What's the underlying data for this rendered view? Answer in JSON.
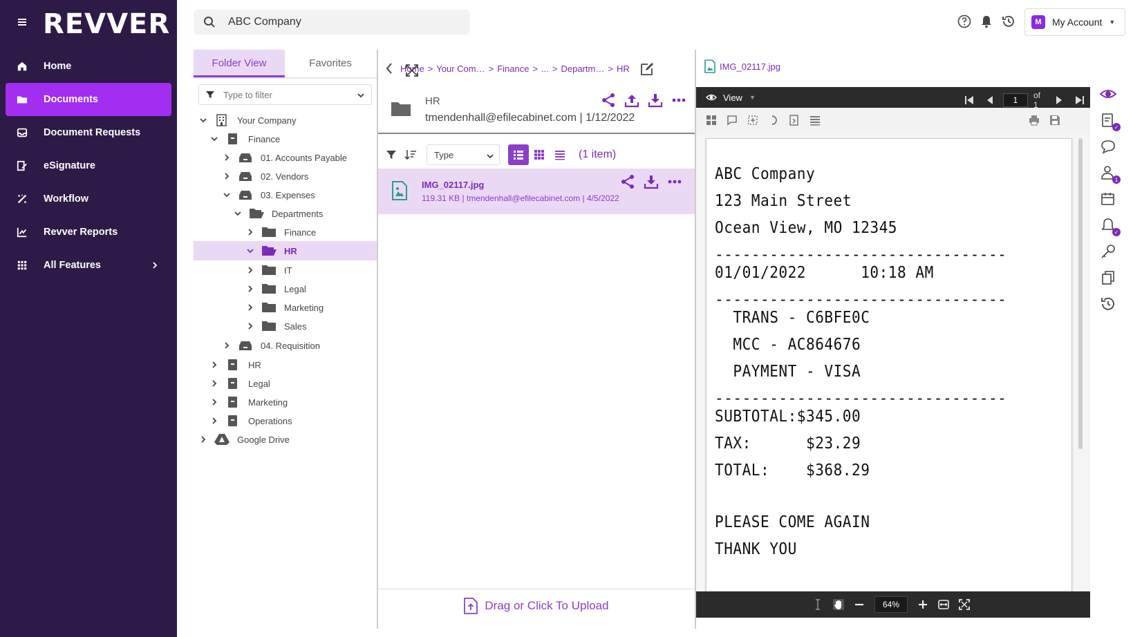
{
  "brand": {
    "logo": "REVVER"
  },
  "sidebar": {
    "items": [
      {
        "label": "Home",
        "icon": "home-icon",
        "active": false
      },
      {
        "label": "Documents",
        "icon": "documents-icon",
        "active": true
      },
      {
        "label": "Document Requests",
        "icon": "document-requests-icon",
        "active": false
      },
      {
        "label": "eSignature",
        "icon": "esignature-icon",
        "active": false
      },
      {
        "label": "Workflow",
        "icon": "workflow-icon",
        "active": false
      },
      {
        "label": "Revver Reports",
        "icon": "reports-icon",
        "active": false
      },
      {
        "label": "All Features",
        "icon": "grid-icon",
        "active": false
      }
    ]
  },
  "search": {
    "value": "ABC Company"
  },
  "account": {
    "initial": "M",
    "label": "My Account"
  },
  "tree": {
    "tabs": [
      "Folder View",
      "Favorites"
    ],
    "active_tab": "Folder View",
    "filter_placeholder": "Type to filter",
    "nodes": [
      {
        "label": "Your Company",
        "depth": 0,
        "expanded": true,
        "icon": "building-icon"
      },
      {
        "label": "Finance",
        "depth": 1,
        "expanded": true,
        "icon": "cabinet-icon"
      },
      {
        "label": "01. Accounts Payable",
        "depth": 2,
        "expanded": false,
        "icon": "drawer-icon"
      },
      {
        "label": "02. Vendors",
        "depth": 2,
        "expanded": false,
        "icon": "drawer-icon"
      },
      {
        "label": "03. Expenses",
        "depth": 2,
        "expanded": true,
        "icon": "drawer-icon"
      },
      {
        "label": "Departments",
        "depth": 3,
        "expanded": true,
        "icon": "folder-open-icon"
      },
      {
        "label": "Finance",
        "depth": 4,
        "expanded": false,
        "icon": "folder-icon"
      },
      {
        "label": "HR",
        "depth": 4,
        "expanded": true,
        "icon": "folder-open-icon",
        "selected": true
      },
      {
        "label": "IT",
        "depth": 4,
        "expanded": false,
        "icon": "folder-icon"
      },
      {
        "label": "Legal",
        "depth": 4,
        "expanded": false,
        "icon": "folder-icon"
      },
      {
        "label": "Marketing",
        "depth": 4,
        "expanded": false,
        "icon": "folder-icon"
      },
      {
        "label": "Sales",
        "depth": 4,
        "expanded": false,
        "icon": "folder-icon"
      },
      {
        "label": "04. Requisition",
        "depth": 2,
        "expanded": false,
        "icon": "drawer-icon"
      },
      {
        "label": "HR",
        "depth": 1,
        "expanded": false,
        "icon": "cabinet-icon"
      },
      {
        "label": "Legal",
        "depth": 1,
        "expanded": false,
        "icon": "cabinet-icon"
      },
      {
        "label": "Marketing",
        "depth": 1,
        "expanded": false,
        "icon": "cabinet-icon"
      },
      {
        "label": "Operations",
        "depth": 1,
        "expanded": false,
        "icon": "cabinet-icon"
      },
      {
        "label": "Google Drive",
        "depth": 0,
        "expanded": false,
        "icon": "google-drive-icon"
      }
    ]
  },
  "breadcrumb": [
    "Home",
    "Your Com…",
    "Finance",
    "...",
    "Departm…",
    "HR"
  ],
  "folder": {
    "name": "HR",
    "meta": "tmendenhall@efilecabinet.com | 1/12/2022"
  },
  "list": {
    "type_filter": "Type",
    "count": "(1 item)",
    "files": [
      {
        "name": "IMG_02117.jpg",
        "meta": "119.31 KB | tmendenhall@efilecabinet.com | 4/5/2022"
      }
    ],
    "upload_label": "Drag or Click To Upload"
  },
  "viewer": {
    "file_name": "IMG_02117.jpg",
    "mode_label": "View",
    "page_current": "1",
    "page_total": "of 1",
    "zoom": "64%",
    "receipt_lines": [
      "ABC Company",
      "123 Main Street",
      "Ocean View, MO 12345",
      "--------------------------------",
      "01/01/2022      10:18 AM",
      "--------------------------------",
      "  TRANS - C6BFE0C",
      "  MCC - AC864676",
      "  PAYMENT - VISA",
      "--------------------------------",
      "SUBTOTAL:$345.00",
      "TAX:      $23.29",
      "TOTAL:    $368.29",
      "PLEASE COME AGAIN",
      "THANK YOU"
    ]
  },
  "rail": {
    "badge_count": "1"
  },
  "colors": {
    "sidebar_bg": "#2e1a47",
    "accent": "#a12ef0",
    "purple_text": "#7a2bb8",
    "selection_bg": "#ead9f5"
  }
}
